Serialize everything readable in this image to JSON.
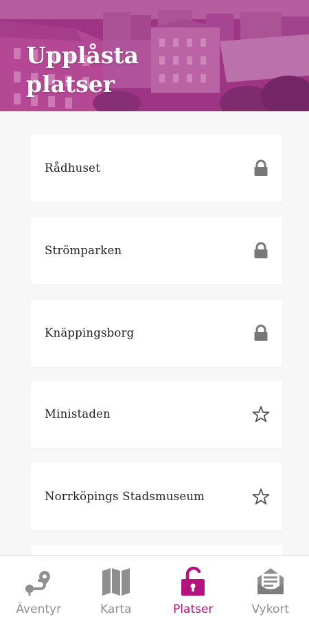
{
  "header": {
    "title": "Upplåsta platser"
  },
  "places": [
    {
      "name": "Rådhuset",
      "status": "locked",
      "icon": "lock-icon"
    },
    {
      "name": "Strömparken",
      "status": "locked",
      "icon": "lock-icon"
    },
    {
      "name": "Knäppingsborg",
      "status": "locked",
      "icon": "lock-icon"
    },
    {
      "name": "Ministaden",
      "status": "unlocked",
      "icon": "star-outline-icon"
    },
    {
      "name": "Norrköpings Stadsmuseum",
      "status": "unlocked",
      "icon": "star-outline-icon"
    }
  ],
  "nav": {
    "items": [
      {
        "label": "Äventyr",
        "icon": "route-icon",
        "active": false
      },
      {
        "label": "Karta",
        "icon": "map-icon",
        "active": false
      },
      {
        "label": "Platser",
        "icon": "unlock-icon",
        "active": true
      },
      {
        "label": "Vykort",
        "icon": "postcard-icon",
        "active": false
      }
    ]
  },
  "colors": {
    "accent": "#b5117f",
    "header_tint": "#a4418a",
    "icon_gray": "#777777",
    "nav_inactive": "#8f8f8f"
  }
}
